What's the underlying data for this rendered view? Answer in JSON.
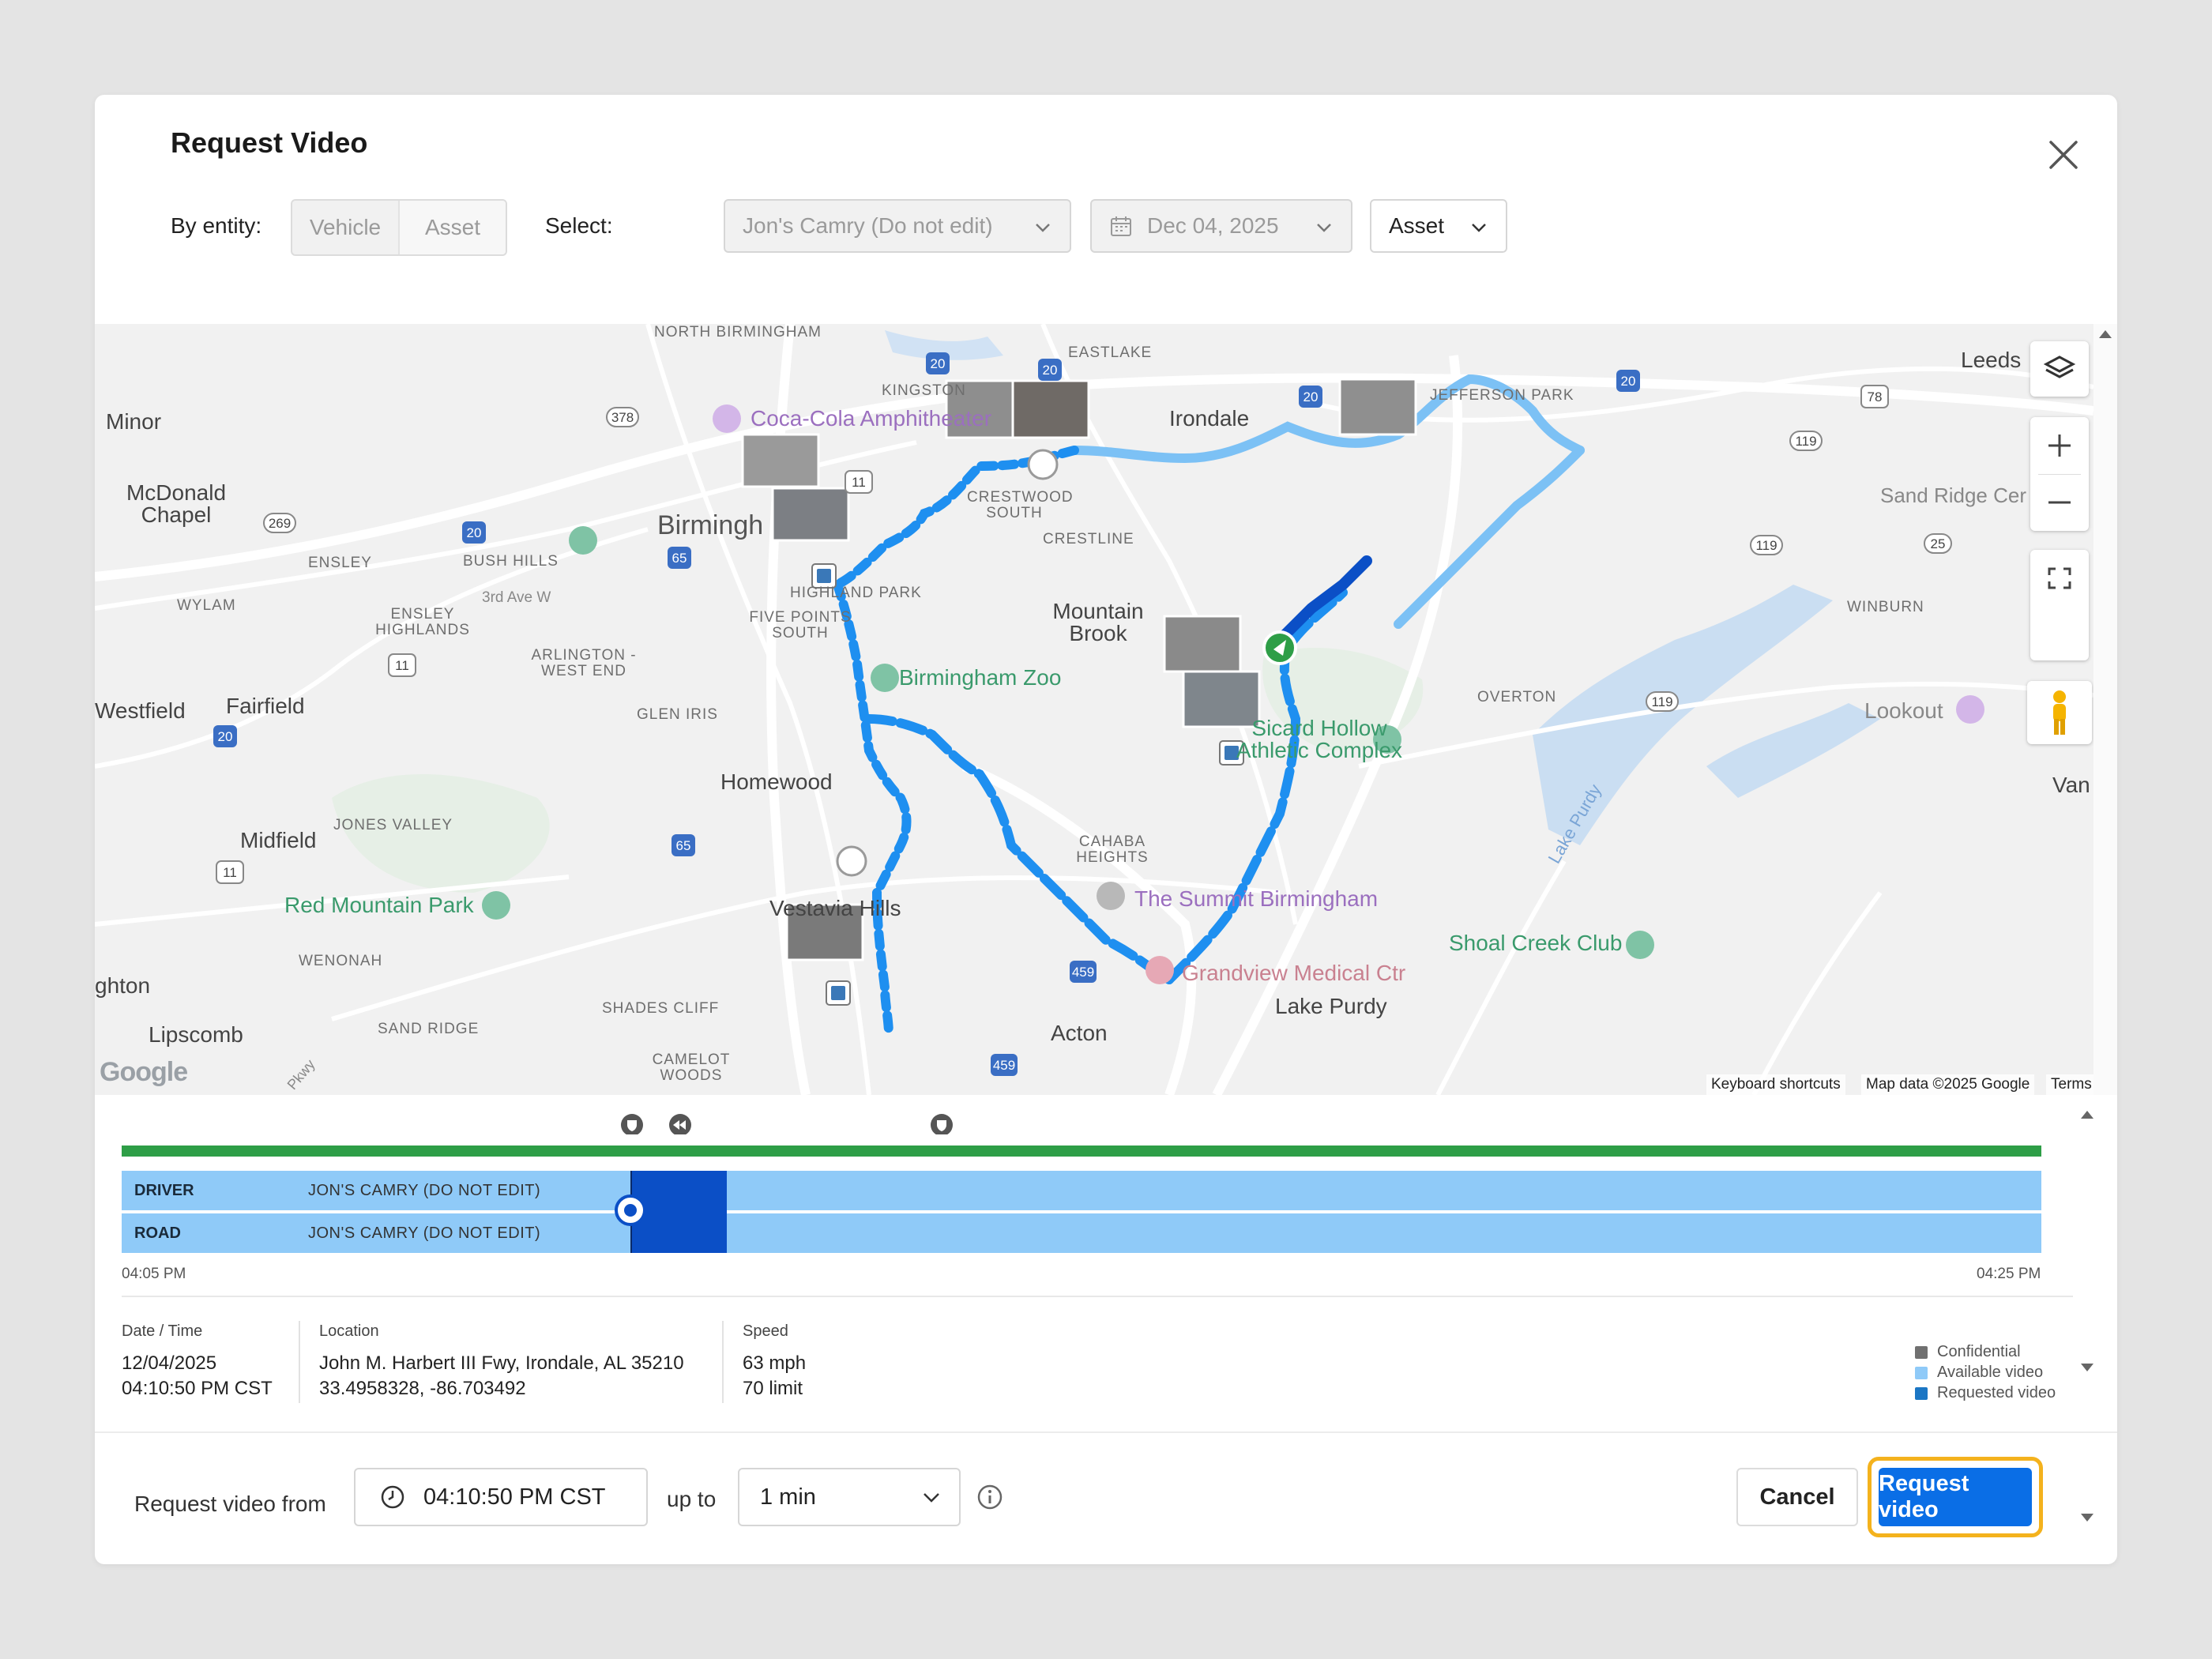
{
  "dialog": {
    "title": "Request Video",
    "close_icon": "close-icon"
  },
  "filters": {
    "entity_label": "By entity:",
    "entity_options": [
      "Vehicle",
      "Asset"
    ],
    "select_label": "Select:",
    "vehicle_value": "Jon's Camry (Do not edit)",
    "date_value": "Dec 04, 2025",
    "type_value": "Asset"
  },
  "map": {
    "places": {
      "north_birmingham": "NORTH BIRMINGHAM",
      "eastlake": "EASTLAKE",
      "kingston": "KINGSTON",
      "leeds": "Leeds",
      "minor": "Minor",
      "coca_cola": "Coca-Cola Amphitheater",
      "irondale": "Irondale",
      "jefferson_park": "JEFFERSON PARK",
      "mcdonald_chapel": "McDonald Chapel",
      "crestwood_south": "CRESTWOOD SOUTH",
      "sand_ridge": "Sand Ridge Cer",
      "birmingham": "Birmingh",
      "crestline": "CRESTLINE",
      "ensley": "ENSLEY",
      "bush_hills": "BUSH HILLS",
      "third_ave": "3rd Ave W",
      "highland_park": "HIGHLAND PARK",
      "wylam": "WYLAM",
      "ensley_highlands": "ENSLEY HIGHLANDS",
      "five_points": "FIVE POINTS SOUTH",
      "mountain_brook": "Mountain Brook",
      "winburn": "WINBURN",
      "arlington": "ARLINGTON - WEST END",
      "birmingham_zoo": "Birmingham Zoo",
      "westfield": "Westfield",
      "fairfield": "Fairfield",
      "glen_iris": "GLEN IRIS",
      "overton": "OVERTON",
      "lookout": "Lookout",
      "sicard": "Sicard Hollow Athletic Complex",
      "homewood": "Homewood",
      "van": "Van",
      "jones_valley": "JONES VALLEY",
      "midfield": "Midfield",
      "cahaba_heights": "CAHABA HEIGHTS",
      "lake_purdy_water": "Lake Purdy",
      "red_mountain": "Red Mountain Park",
      "summit": "The Summit Birmingham",
      "vestavia": "Vestavia Hills",
      "shoal_creek": "Shoal Creek Club",
      "wenonah": "WENONAH",
      "grandview": "Grandview Medical Ctr",
      "hton": "ghton",
      "lake_purdy": "Lake Purdy",
      "shades_cliff": "SHADES CLIFF",
      "sand_ridge_small": "SAND RIDGE",
      "acton": "Acton",
      "lipscomb": "Lipscomb",
      "camelot_woods": "CAMELOT WOODS",
      "pkwy": "Pkwy"
    },
    "shields": [
      "20",
      "20",
      "20",
      "20",
      "78",
      "378",
      "11",
      "119",
      "269",
      "20",
      "65",
      "119",
      "25",
      "11",
      "119",
      "20",
      "65",
      "11",
      "459",
      "459"
    ],
    "attribution": {
      "keyboard": "Keyboard shortcuts",
      "data": "Map data ©2025 Google",
      "terms": "Terms",
      "logo": "Google"
    },
    "controls": {
      "layers": "layers-icon",
      "zoom_in": "plus-icon",
      "zoom_out": "minus-icon",
      "fullscreen": "fullscreen-icon",
      "pegman": "pegman-icon"
    }
  },
  "timeline": {
    "tracks": [
      {
        "name": "DRIVER",
        "vehicle": "JON'S CAMRY (DO NOT EDIT)"
      },
      {
        "name": "ROAD",
        "vehicle": "JON'S CAMRY (DO NOT EDIT)"
      }
    ],
    "start_time": "04:05 PM",
    "end_time": "04:25 PM"
  },
  "details": {
    "datetime_label": "Date / Time",
    "date": "12/04/2025",
    "time": "04:10:50 PM CST",
    "location_label": "Location",
    "address": "John M. Harbert III Fwy, Irondale, AL 35210",
    "coords": "33.4958328, -86.703492",
    "speed_label": "Speed",
    "speed": "63 mph",
    "limit": "70 limit"
  },
  "legend": [
    {
      "label": "Confidential",
      "color": "#707070"
    },
    {
      "label": "Available video",
      "color": "#8fcaf8"
    },
    {
      "label": "Requested video",
      "color": "#1b76c4"
    }
  ],
  "footer": {
    "from_label": "Request video from",
    "from_time": "04:10:50 PM CST",
    "up_to_label": "up to",
    "duration": "1 min",
    "cancel": "Cancel",
    "request": "Request video"
  },
  "colors": {
    "primary": "#0a6ee6",
    "focus_ring": "#f4b21d",
    "route": "#1e8ff0",
    "route_light": "#7cc1f5",
    "timeline_green": "#2e9e47",
    "available": "#8fcaf8",
    "requested": "#0b4fc6"
  }
}
